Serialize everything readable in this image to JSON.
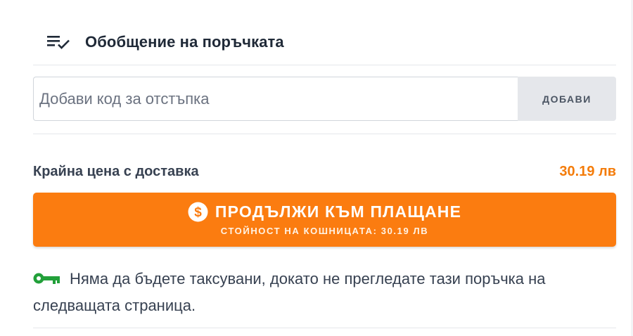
{
  "summary": {
    "title": "Обобщение на поръчката",
    "header_icon": "list-check-icon"
  },
  "coupon": {
    "placeholder": "Добави код за отстъпка",
    "value": "",
    "apply_label": "ДОБАВИ"
  },
  "total": {
    "label": "Крайна цена с доставка",
    "value": "30.19 лв"
  },
  "checkout": {
    "icon": "dollar-coin-icon",
    "label": "ПРОДЪЛЖИ КЪМ ПЛАЩАНЕ",
    "sublabel": "СТОЙНОСТ НА КОШНИЦАТА: 30.19 ЛВ"
  },
  "notice": {
    "icon": "key-icon",
    "text": "Няма да бъдете таксувани, докато не прегледате тази поръчка на следващата страница."
  },
  "colors": {
    "accent": "#fb7c10",
    "price": "#f47c0a",
    "key": "#22a03a",
    "button_gray": "#e5e7eb"
  }
}
